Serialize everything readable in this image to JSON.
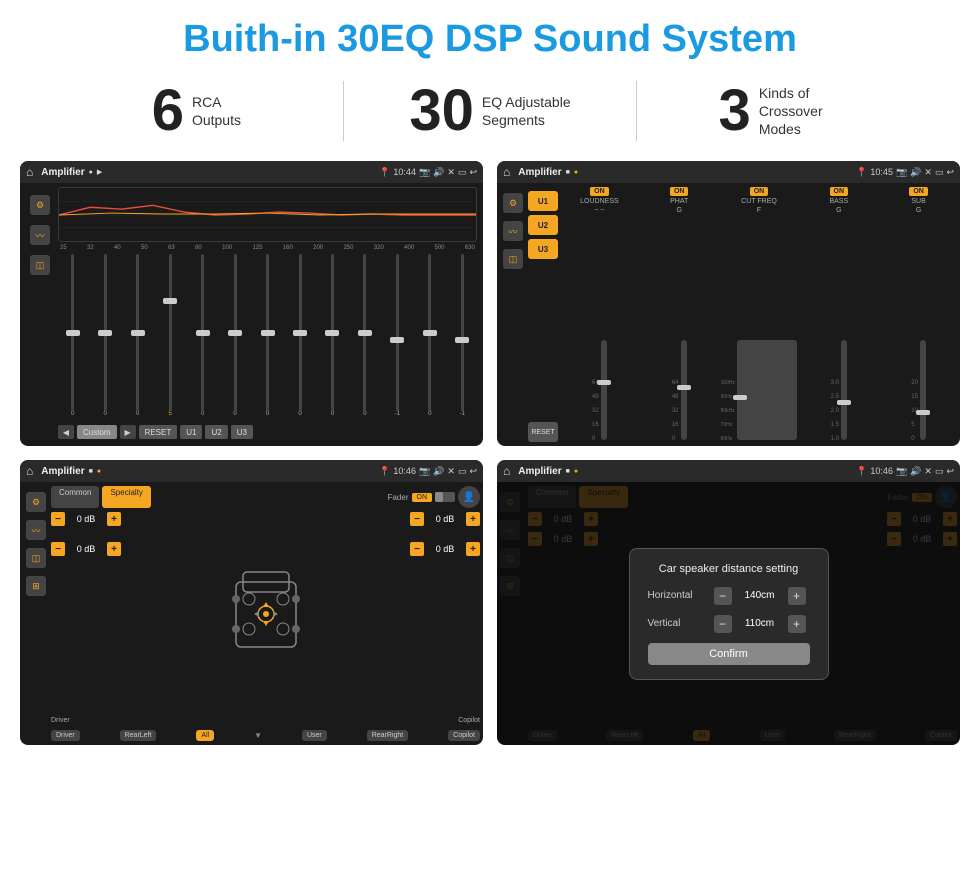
{
  "header": {
    "title": "Buith-in 30EQ DSP Sound System"
  },
  "stats": [
    {
      "number": "6",
      "label": "RCA\nOutputs"
    },
    {
      "number": "30",
      "label": "EQ Adjustable\nSegments"
    },
    {
      "number": "3",
      "label": "Kinds of\nCrossover Modes"
    }
  ],
  "screens": {
    "eq": {
      "status_title": "Amplifier",
      "time": "10:44",
      "freq_labels": [
        "25",
        "32",
        "40",
        "50",
        "63",
        "80",
        "100",
        "125",
        "160",
        "200",
        "250",
        "320",
        "400",
        "500",
        "630"
      ],
      "slider_values": [
        "0",
        "0",
        "0",
        "5",
        "0",
        "0",
        "0",
        "0",
        "0",
        "0",
        "-1",
        "0",
        "-1"
      ],
      "bottom_labels": [
        "Custom",
        "RESET",
        "U1",
        "U2",
        "U3"
      ]
    },
    "amp2": {
      "status_title": "Amplifier",
      "time": "10:45",
      "presets": [
        "U1",
        "U2",
        "U3"
      ],
      "controls": [
        {
          "on": true,
          "label": "LOUDNESS"
        },
        {
          "on": true,
          "label": "PHAT"
        },
        {
          "on": true,
          "label": "CUT FREQ"
        },
        {
          "on": true,
          "label": "BASS"
        },
        {
          "on": true,
          "label": "SUB"
        }
      ]
    },
    "fader": {
      "status_title": "Amplifier",
      "time": "10:46",
      "tabs": [
        "Common",
        "Specialty"
      ],
      "fader_label": "Fader",
      "on_label": "ON",
      "db_values": [
        "0 dB",
        "0 dB",
        "0 dB",
        "0 dB"
      ],
      "bottom_btns": [
        "Driver",
        "RearLeft",
        "All",
        "User",
        "RearRight",
        "Copilot"
      ]
    },
    "speaker": {
      "status_title": "Amplifier",
      "time": "10:46",
      "tabs": [
        "Common",
        "Specialty"
      ],
      "on_label": "ON",
      "modal": {
        "title": "Car speaker distance setting",
        "horizontal_label": "Horizontal",
        "horizontal_value": "140cm",
        "vertical_label": "Vertical",
        "vertical_value": "110cm",
        "confirm_label": "Confirm"
      },
      "bottom_btns": [
        "Driver",
        "RearLeft",
        "All",
        "User",
        "RearRight",
        "Copilot"
      ]
    }
  }
}
